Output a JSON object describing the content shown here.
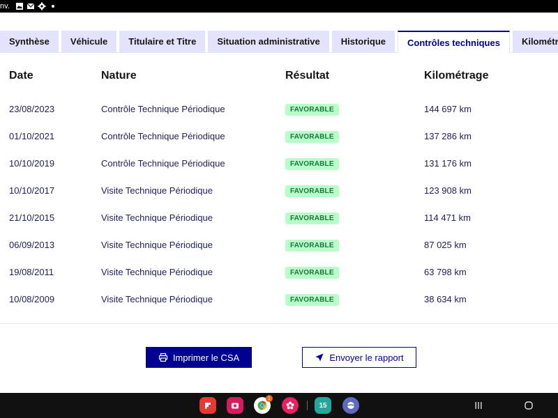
{
  "statusbar": {
    "text": "nv."
  },
  "tabs": [
    {
      "label": "Synthèse",
      "active": false
    },
    {
      "label": "Véhicule",
      "active": false
    },
    {
      "label": "Titulaire et Titre",
      "active": false
    },
    {
      "label": "Situation administrative",
      "active": false
    },
    {
      "label": "Historique",
      "active": false
    },
    {
      "label": "Contrôles techniques",
      "active": true
    },
    {
      "label": "Kilométrage",
      "active": false
    }
  ],
  "table": {
    "headers": {
      "date": "Date",
      "nature": "Nature",
      "result": "Résultat",
      "mileage": "Kilométrage"
    },
    "rows": [
      {
        "date": "23/08/2023",
        "nature": "Contrôle Technique Périodique",
        "result": "FAVORABLE",
        "mileage": "144 697 km"
      },
      {
        "date": "01/10/2021",
        "nature": "Contrôle Technique Périodique",
        "result": "FAVORABLE",
        "mileage": "137 286 km"
      },
      {
        "date": "10/10/2019",
        "nature": "Contrôle Technique Périodique",
        "result": "FAVORABLE",
        "mileage": "131 176 km"
      },
      {
        "date": "10/10/2017",
        "nature": "Visite Technique Périodique",
        "result": "FAVORABLE",
        "mileage": "123 908 km"
      },
      {
        "date": "21/10/2015",
        "nature": "Visite Technique Périodique",
        "result": "FAVORABLE",
        "mileage": "114 471 km"
      },
      {
        "date": "06/09/2013",
        "nature": "Visite Technique Périodique",
        "result": "FAVORABLE",
        "mileage": "87 025 km"
      },
      {
        "date": "19/08/2011",
        "nature": "Visite Technique Périodique",
        "result": "FAVORABLE",
        "mileage": "63 798 km"
      },
      {
        "date": "10/08/2009",
        "nature": "Visite Technique Périodique",
        "result": "FAVORABLE",
        "mileage": "38 634 km"
      }
    ]
  },
  "actions": {
    "print_label": "Imprimer le CSA",
    "send_label": "Envoyer le rapport"
  },
  "dock": {
    "calendar_day": "15",
    "chrome_badge": "1"
  },
  "colors": {
    "primary": "#000091",
    "tab_bg": "#e3e3fd",
    "badge_bg": "#b8fec9",
    "badge_text": "#18753c"
  }
}
